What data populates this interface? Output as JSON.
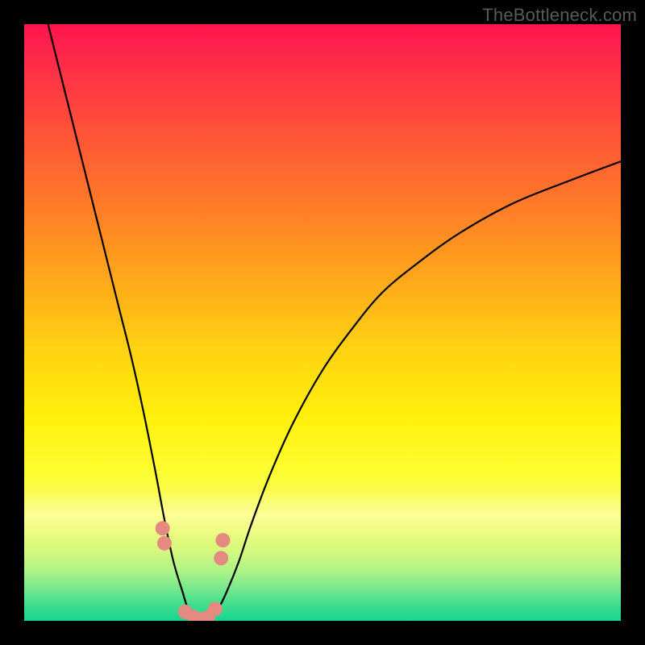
{
  "watermark": {
    "text": "TheBottleneck.com"
  },
  "chart_data": {
    "type": "line",
    "title": "",
    "xlabel": "",
    "ylabel": "",
    "xlim": [
      0,
      100
    ],
    "ylim": [
      0,
      100
    ],
    "grid": false,
    "legend": false,
    "series": [
      {
        "name": "bottleneck-curve",
        "color": "#000000",
        "x": [
          4,
          6,
          8,
          10,
          12,
          14,
          16,
          18,
          20,
          22,
          23.5,
          25,
          26.5,
          27.5,
          29,
          30,
          31,
          32.5,
          34,
          36,
          38,
          41,
          45,
          50,
          55,
          60,
          66,
          73,
          82,
          92,
          100
        ],
        "y": [
          100,
          92,
          84,
          76,
          68,
          60,
          52,
          44,
          35,
          25,
          17,
          10,
          5,
          2,
          0.5,
          0,
          0.5,
          2,
          5,
          10,
          16,
          24,
          33,
          42,
          49,
          55,
          60,
          65,
          70,
          74,
          77
        ]
      },
      {
        "name": "marker-dots",
        "color": "#e58a80",
        "type": "scatter",
        "x": [
          23.2,
          23.5,
          27.0,
          28.5,
          30.0,
          30.8,
          32.0,
          33.0,
          33.3
        ],
        "y": [
          15.5,
          13.0,
          1.5,
          0.6,
          0.3,
          0.6,
          2.0,
          10.5,
          13.5
        ]
      }
    ],
    "background": {
      "type": "vertical-gradient",
      "stops": [
        {
          "pos": 0.0,
          "color": "#ff154f"
        },
        {
          "pos": 0.18,
          "color": "#ff5238"
        },
        {
          "pos": 0.42,
          "color": "#ffa51b"
        },
        {
          "pos": 0.66,
          "color": "#fff10c"
        },
        {
          "pos": 0.85,
          "color": "#d8f97e"
        },
        {
          "pos": 1.0,
          "color": "#17d48f"
        }
      ]
    }
  }
}
